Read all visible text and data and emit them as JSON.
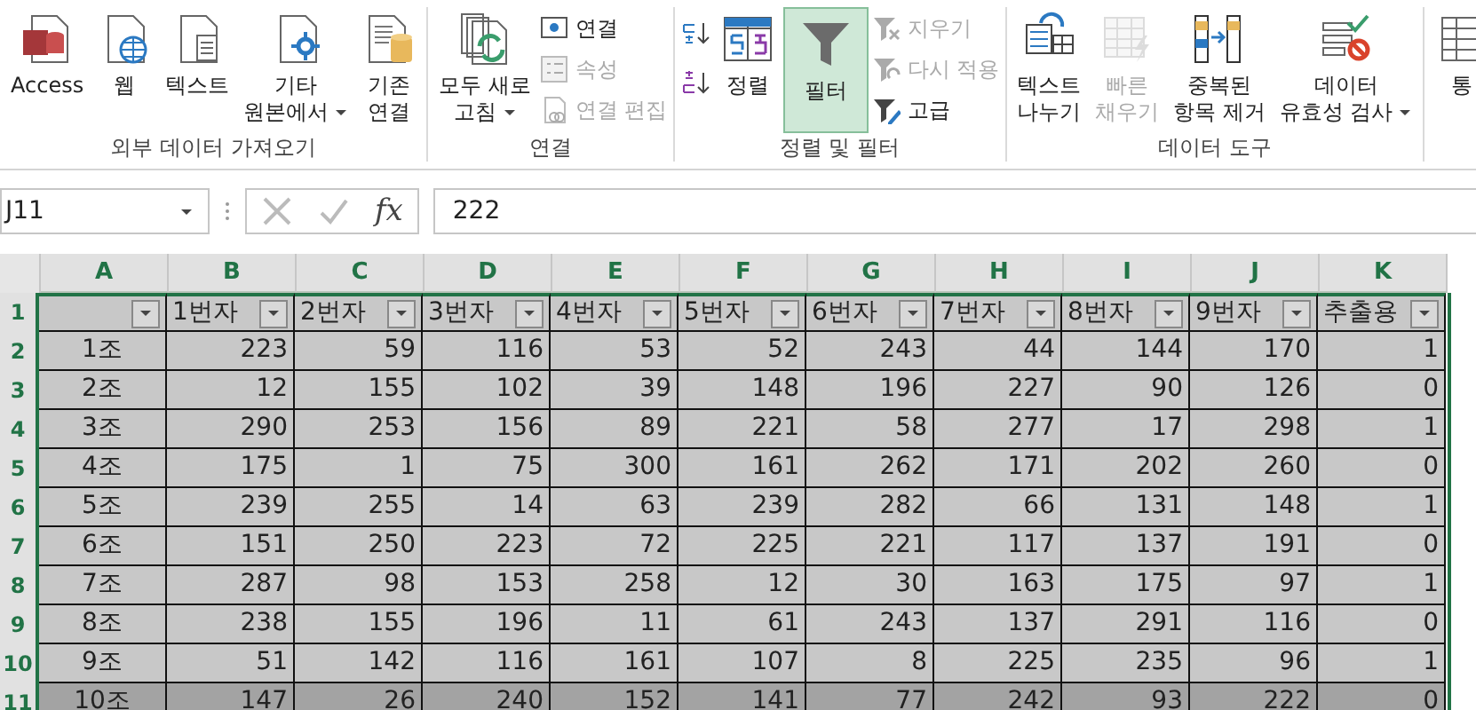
{
  "ribbon": {
    "groups": [
      {
        "label": "외부 데이터 가져오기",
        "buttons": [
          {
            "kind": "large",
            "lines": [
              "Access"
            ],
            "dropdown": false,
            "disabled": false,
            "selected": false
          },
          {
            "kind": "large",
            "lines": [
              "웹"
            ],
            "dropdown": false,
            "disabled": false,
            "selected": false
          },
          {
            "kind": "large",
            "lines": [
              "텍스트"
            ],
            "dropdown": false,
            "disabled": false,
            "selected": false
          },
          {
            "kind": "large",
            "lines": [
              "기타",
              "원본에서"
            ],
            "dropdown": true,
            "disabled": false,
            "selected": false
          },
          {
            "kind": "large",
            "lines": [
              "기존",
              "연결"
            ],
            "dropdown": false,
            "disabled": false,
            "selected": false
          }
        ]
      },
      {
        "label": "연결",
        "buttons": [
          {
            "kind": "large",
            "lines": [
              "모두 새로",
              "고침"
            ],
            "dropdown": true,
            "disabled": false,
            "selected": false
          },
          {
            "kind": "stack",
            "items": [
              {
                "label": "연결",
                "disabled": false
              },
              {
                "label": "속성",
                "disabled": true
              },
              {
                "label": "연결 편집",
                "disabled": true
              }
            ]
          }
        ]
      },
      {
        "label": "정렬 및 필터",
        "buttons": [
          {
            "kind": "sort"
          },
          {
            "kind": "large",
            "lines": [
              "정렬"
            ],
            "dropdown": false,
            "disabled": false,
            "selected": false
          },
          {
            "kind": "large",
            "lines": [
              "필터"
            ],
            "dropdown": false,
            "disabled": false,
            "selected": true
          },
          {
            "kind": "stack",
            "items": [
              {
                "label": "지우기",
                "disabled": true
              },
              {
                "label": "다시 적용",
                "disabled": true
              },
              {
                "label": "고급",
                "disabled": false
              }
            ]
          }
        ]
      },
      {
        "label": "데이터 도구",
        "buttons": [
          {
            "kind": "large",
            "lines": [
              "텍스트",
              "나누기"
            ],
            "dropdown": false,
            "disabled": false,
            "selected": false
          },
          {
            "kind": "large",
            "lines": [
              "빠른",
              "채우기"
            ],
            "dropdown": false,
            "disabled": true,
            "selected": false
          },
          {
            "kind": "large",
            "lines": [
              "중복된",
              "항목 제거"
            ],
            "dropdown": false,
            "disabled": false,
            "selected": false
          },
          {
            "kind": "large",
            "lines": [
              "데이터",
              "유효성 검사"
            ],
            "dropdown": true,
            "disabled": false,
            "selected": false
          }
        ]
      },
      {
        "buttons": [
          {
            "kind": "large",
            "lines": [
              "통"
            ],
            "dropdown": false,
            "disabled": false,
            "selected": false
          }
        ]
      }
    ]
  },
  "formula_bar": {
    "name_box": "J11",
    "function_label": "fx",
    "value": "222"
  },
  "sheet": {
    "columns": [
      "A",
      "B",
      "C",
      "D",
      "E",
      "F",
      "G",
      "H",
      "I",
      "J",
      "K"
    ],
    "header_row": {
      "number": "1",
      "cells": [
        "",
        "1번자",
        "2번자",
        "3번자",
        "4번자",
        "5번자",
        "6번자",
        "7번자",
        "8번자",
        "9번자",
        "추출용"
      ]
    },
    "rows": [
      {
        "number": "2",
        "selected": false,
        "cells": [
          "1조",
          "223",
          "59",
          "116",
          "53",
          "52",
          "243",
          "44",
          "144",
          "170",
          "1"
        ]
      },
      {
        "number": "3",
        "selected": false,
        "cells": [
          "2조",
          "12",
          "155",
          "102",
          "39",
          "148",
          "196",
          "227",
          "90",
          "126",
          "0"
        ]
      },
      {
        "number": "4",
        "selected": false,
        "cells": [
          "3조",
          "290",
          "253",
          "156",
          "89",
          "221",
          "58",
          "277",
          "17",
          "298",
          "1"
        ]
      },
      {
        "number": "5",
        "selected": false,
        "cells": [
          "4조",
          "175",
          "1",
          "75",
          "300",
          "161",
          "262",
          "171",
          "202",
          "260",
          "0"
        ]
      },
      {
        "number": "6",
        "selected": false,
        "cells": [
          "5조",
          "239",
          "255",
          "14",
          "63",
          "239",
          "282",
          "66",
          "131",
          "148",
          "1"
        ]
      },
      {
        "number": "7",
        "selected": false,
        "cells": [
          "6조",
          "151",
          "250",
          "223",
          "72",
          "225",
          "221",
          "117",
          "137",
          "191",
          "0"
        ]
      },
      {
        "number": "8",
        "selected": false,
        "cells": [
          "7조",
          "287",
          "98",
          "153",
          "258",
          "12",
          "30",
          "163",
          "175",
          "97",
          "1"
        ]
      },
      {
        "number": "9",
        "selected": false,
        "cells": [
          "8조",
          "238",
          "155",
          "196",
          "11",
          "61",
          "243",
          "137",
          "291",
          "116",
          "0"
        ]
      },
      {
        "number": "10",
        "selected": false,
        "cells": [
          "9조",
          "51",
          "142",
          "116",
          "161",
          "107",
          "8",
          "225",
          "235",
          "96",
          "1"
        ]
      },
      {
        "number": "11",
        "selected": true,
        "cells": [
          "10조",
          "147",
          "26",
          "240",
          "152",
          "141",
          "77",
          "242",
          "93",
          "222",
          "0"
        ]
      }
    ]
  }
}
